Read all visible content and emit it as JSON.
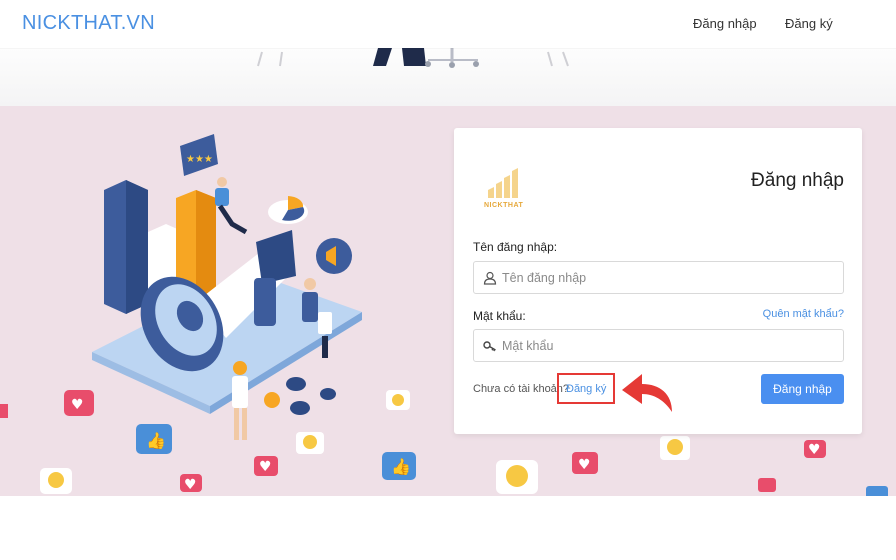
{
  "header": {
    "brand": "NICKTHAT.VN",
    "nav": {
      "login": "Đăng nhập",
      "register": "Đăng ký"
    }
  },
  "card": {
    "logo_text": "NICKTHAT",
    "title": "Đăng nhập",
    "username": {
      "label": "Tên đăng nhập:",
      "placeholder": "Tên đăng nhập",
      "value": ""
    },
    "password": {
      "label": "Mật khẩu:",
      "placeholder": "Mật khẩu",
      "value": ""
    },
    "forgot_label": "Quên mật khẩu?",
    "no_account_text": "Chưa có tài khoản?",
    "register_link": "Đăng ký",
    "submit_label": "Đăng nhập"
  },
  "colors": {
    "brand": "#4a90e2",
    "hero_bg": "#efe0e7",
    "primary_button": "#4a8ff0",
    "annotation_red": "#e53935"
  },
  "icons": [
    "user-icon",
    "key-icon",
    "red-curved-arrow-icon"
  ]
}
